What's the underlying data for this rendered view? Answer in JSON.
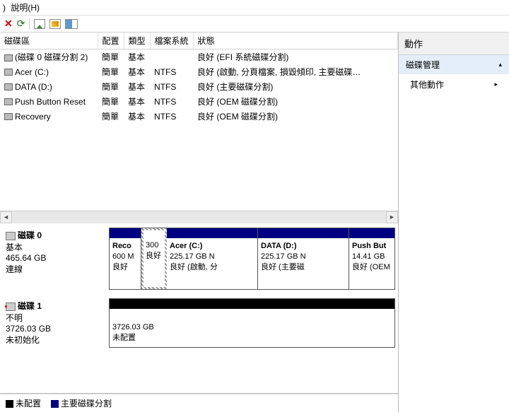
{
  "menu": {
    "view": ")",
    "help": "說明(H)"
  },
  "columns": {
    "vol": "磁碟區",
    "layout": "配置",
    "type": "類型",
    "fs": "檔案系統",
    "status": "狀態"
  },
  "rows": [
    {
      "name": "(磁碟 0 磁碟分割 2)",
      "layout": "簡單",
      "type": "基本",
      "fs": "",
      "status": "良好 (EFI 系統磁碟分割)"
    },
    {
      "name": "Acer (C:)",
      "layout": "簡單",
      "type": "基本",
      "fs": "NTFS",
      "status": "良好 (啟動, 分頁檔案, 損毀傾印, 主要磁碟…"
    },
    {
      "name": "DATA (D:)",
      "layout": "簡單",
      "type": "基本",
      "fs": "NTFS",
      "status": "良好 (主要磁碟分割)"
    },
    {
      "name": "Push Button Reset",
      "layout": "簡單",
      "type": "基本",
      "fs": "NTFS",
      "status": "良好 (OEM 磁碟分割)"
    },
    {
      "name": "Recovery",
      "layout": "簡單",
      "type": "基本",
      "fs": "NTFS",
      "status": "良好 (OEM 磁碟分割)"
    }
  ],
  "disk0": {
    "title": "磁碟 0",
    "type": "基本",
    "size": "465.64 GB",
    "state": "連線",
    "parts": [
      {
        "name": "Reco",
        "size": "600 M",
        "status": "良好"
      },
      {
        "name": "",
        "size": "300",
        "status": "良好"
      },
      {
        "name": "Acer  (C:)",
        "size": "225.17 GB N",
        "status": "良好 (啟動, 分"
      },
      {
        "name": "DATA  (D:)",
        "size": "225.17 GB N",
        "status": "良好 (主要磁"
      },
      {
        "name": "Push But",
        "size": "14.41 GB",
        "status": "良好 (OEM"
      }
    ]
  },
  "disk1": {
    "title": "磁碟 1",
    "type": "不明",
    "size": "3726.03 GB",
    "state": "未初始化",
    "part": {
      "size": "3726.03 GB",
      "status": "未配置"
    }
  },
  "legend": {
    "unalloc": "未配置",
    "primary": "主要磁碟分割"
  },
  "actions": {
    "header": "動作",
    "group": "磁碟管理",
    "other": "其他動作"
  }
}
